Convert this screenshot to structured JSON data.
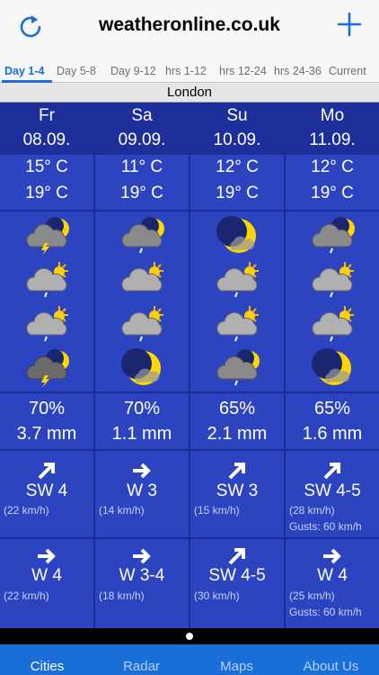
{
  "header": {
    "title": "weatheronline.co.uk"
  },
  "tabs": [
    "Day 1-4",
    "Day 5-8",
    "Day 9-12",
    "hrs 1-12",
    "hrs 12-24",
    "hrs 24-36",
    "Current"
  ],
  "city": "London",
  "days": [
    {
      "day": "Fr",
      "date": "08.09.",
      "temp_min": "15° C",
      "temp_max": "19° C",
      "icons": [
        "night-cloud-thunder-icon",
        "cloud-sun-rain-icon",
        "cloud-sun-rain-icon",
        "night-thunderstorm-icon"
      ],
      "precip_prob": "70%",
      "precip_amt": "3.7 mm",
      "wind1_dir": "SW 4",
      "wind1_kmh": "(22 km/h)",
      "wind1_gusts": "",
      "wind2_dir": "W 4",
      "wind2_kmh": "(22 km/h)",
      "wind2_gusts": ""
    },
    {
      "day": "Sa",
      "date": "09.09.",
      "temp_min": "11° C",
      "temp_max": "19° C",
      "icons": [
        "night-cloud-rain-icon",
        "cloud-sun-icon",
        "cloud-sun-rain-icon",
        "moon-cloud-icon"
      ],
      "precip_prob": "70%",
      "precip_amt": "1.1 mm",
      "wind1_dir": "W 3",
      "wind1_kmh": "(14 km/h)",
      "wind1_gusts": "",
      "wind2_dir": "W 3-4",
      "wind2_kmh": "(18 km/h)",
      "wind2_gusts": ""
    },
    {
      "day": "Su",
      "date": "10.09.",
      "temp_min": "12° C",
      "temp_max": "19° C",
      "icons": [
        "moon-cloud-icon",
        "cloud-sun-rain-icon",
        "cloud-sun-rain-icon",
        "night-cloud-rain-icon"
      ],
      "precip_prob": "65%",
      "precip_amt": "2.1 mm",
      "wind1_dir": "SW 3",
      "wind1_kmh": "(15 km/h)",
      "wind1_gusts": "",
      "wind2_dir": "SW 4-5",
      "wind2_kmh": "(30 km/h)",
      "wind2_gusts": ""
    },
    {
      "day": "Mo",
      "date": "11.09.",
      "temp_min": "12° C",
      "temp_max": "19° C",
      "icons": [
        "night-cloud-rain-icon",
        "cloud-sun-rain-icon",
        "cloud-sun-rain-icon",
        "moon-cloud-icon"
      ],
      "precip_prob": "65%",
      "precip_amt": "1.6 mm",
      "wind1_dir": "SW 4-5",
      "wind1_kmh": "(28 km/h)",
      "wind1_gusts": "Gusts: 60 km/h",
      "wind2_dir": "W 4",
      "wind2_kmh": "(25 km/h)",
      "wind2_gusts": "Gusts: 60 km/h"
    }
  ],
  "nav": [
    "Cities",
    "Radar",
    "Maps",
    "About Us"
  ],
  "colors": {
    "accent": "#1a6ed8",
    "grid": "#2d44c0",
    "header": "#1c2f9a"
  }
}
